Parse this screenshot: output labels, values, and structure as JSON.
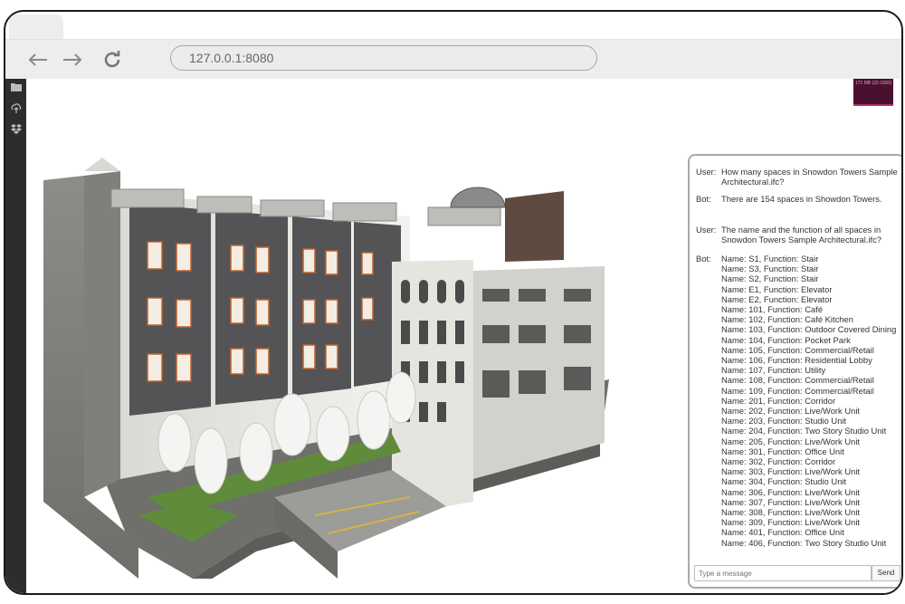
{
  "browser": {
    "url": "127.0.0.1:8080",
    "back_icon": "arrow-left-icon",
    "forward_icon": "arrow-right-icon",
    "reload_icon": "reload-icon"
  },
  "toolbar": {
    "icons": [
      "folder-icon",
      "cloud-upload-icon",
      "dropbox-icon"
    ]
  },
  "memory_widget": {
    "text": "171 MB (32-1683)"
  },
  "chat": {
    "messages": [
      {
        "sender": "User:",
        "lines": [
          "How many spaces in Snowdon Towers Sample",
          "Architectural.ifc?"
        ]
      },
      {
        "sender": "Bot:",
        "lines": [
          "There are 154 spaces in Showdon Towers."
        ]
      },
      {
        "sender": "User:",
        "lines": [
          "The name and the function of all spaces in",
          "Snowdon Towers Sample Architectural.ifc?"
        ]
      },
      {
        "sender": "Bot:",
        "lines": [
          "Name: S1, Function: Stair",
          "Name: S3, Function: Stair",
          "Name: S2, Function: Stair",
          "Name: E1, Function: Elevator",
          "Name: E2, Function: Elevator",
          "Name: 101, Function: Café",
          "Name: 102, Function: Café Kitchen",
          "Name: 103, Function: Outdoor Covered Dining",
          "Name: 104, Function: Pocket Park",
          "Name: 105, Function: Commercial/Retail",
          "Name: 106, Function: Residential Lobby",
          "Name: 107, Function: Utility",
          "Name: 108, Function: Commercial/Retail",
          "Name: 109, Function: Commercial/Retail",
          "Name: 201, Function: Corridor",
          "Name: 202, Function: Live/Work Unit",
          "Name: 203, Function: Studio Unit",
          "Name: 204, Function: Two Story Studio Unit",
          "Name: 205, Function: Live/Work Unit",
          "Name: 301, Function: Office Unit",
          "Name: 302, Function: Corridor",
          "Name: 303, Function: Live/Work Unit",
          "Name: 304, Function: Studio Unit",
          "Name: 306, Function: Live/Work Unit",
          "Name: 307, Function: Live/Work Unit",
          "Name: 308, Function: Live/Work Unit",
          "Name: 309, Function: Live/Work Unit",
          "Name: 401, Function: Office Unit",
          "Name: 406, Function: Two Story Studio Unit"
        ]
      }
    ],
    "input_placeholder": "Type a message",
    "send_label": "Send"
  }
}
